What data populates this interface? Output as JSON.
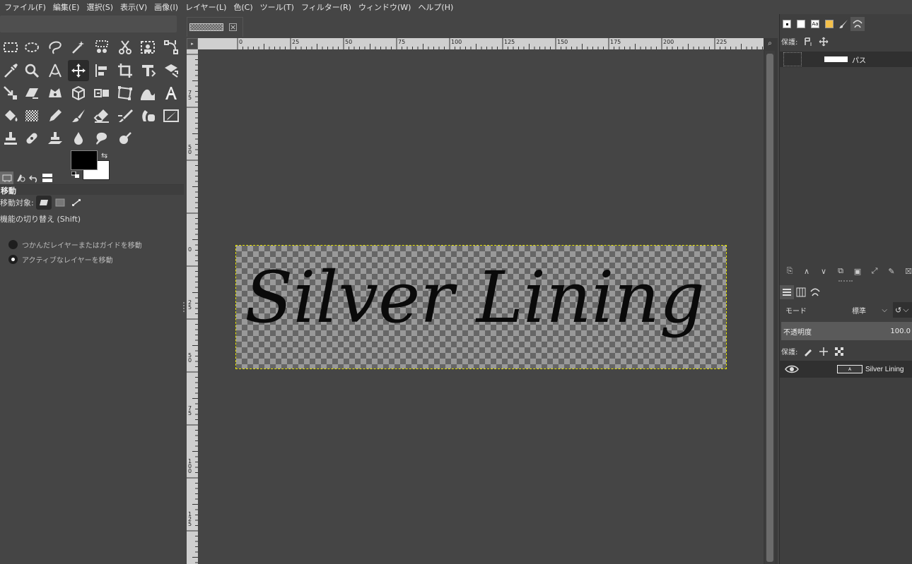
{
  "menubar": {
    "items": [
      "ファイル(F)",
      "編集(E)",
      "選択(S)",
      "表示(V)",
      "画像(I)",
      "レイヤー(L)",
      "色(C)",
      "ツール(T)",
      "フィルター(R)",
      "ウィンドウ(W)",
      "ヘルプ(H)"
    ]
  },
  "toolbox": {
    "colors": {
      "foreground": "#000000",
      "background": "#ffffff"
    },
    "active_tool": "move-tool"
  },
  "tool_options": {
    "title": "移動",
    "move_target_label": "移動対象:",
    "switch_label": "機能の切り替え (Shift)",
    "options": [
      {
        "label": "つかんだレイヤーまたはガイドを移動",
        "selected": false
      },
      {
        "label": "アクティブなレイヤーを移動",
        "selected": true
      }
    ]
  },
  "canvas": {
    "ruler_top": [
      "0",
      "25",
      "50",
      "75",
      "100",
      "125",
      "150",
      "175",
      "200",
      "225"
    ],
    "ruler_left": [
      "0",
      "25",
      "50",
      "75",
      "100",
      "125"
    ],
    "ruler_left_top_partial": [
      "75",
      "50"
    ],
    "text": "Silver Lining"
  },
  "right_dock": {
    "paths": {
      "protect_label": "保護:",
      "item_name": "パス"
    },
    "layers": {
      "mode_label": "モード",
      "mode_value": "標準",
      "opacity_label": "不透明度",
      "opacity_value": "100.0",
      "protect_label": "保護:",
      "layer_name": "Silver Lining"
    }
  }
}
